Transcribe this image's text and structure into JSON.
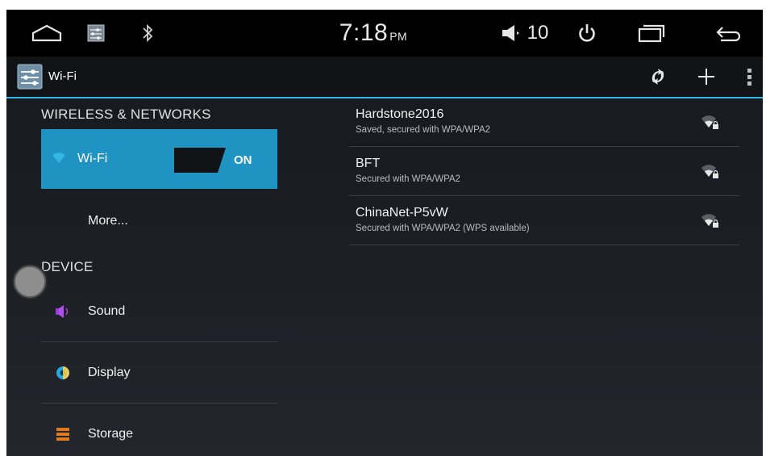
{
  "statusbar": {
    "time": "7:18",
    "ampm": "PM",
    "volume": "10",
    "icons": [
      "home-icon",
      "settings-app-icon",
      "bluetooth-icon",
      "volume-icon",
      "power-icon",
      "recents-icon",
      "back-icon"
    ]
  },
  "actionbar": {
    "title": "Wi-Fi",
    "icons": [
      "settings-app-icon",
      "wps-icon",
      "add-network-icon",
      "overflow-menu-icon"
    ]
  },
  "left": {
    "wireless_header": "WIRELESS & NETWORKS",
    "wifi_label": "Wi-Fi",
    "wifi_toggle": "ON",
    "more_label": "More...",
    "device_header": "DEVICE",
    "sound_label": "Sound",
    "display_label": "Display",
    "storage_label": "Storage"
  },
  "networks": [
    {
      "name": "Hardstone2016",
      "status": "Saved, secured with WPA/WPA2"
    },
    {
      "name": "BFT",
      "status": "Secured with WPA/WPA2"
    },
    {
      "name": "ChinaNet-P5vW",
      "status": "Secured with WPA/WPA2 (WPS available)"
    }
  ],
  "colors": {
    "accent": "#33b5e5",
    "selected_bg": "#1f93c2",
    "sound_icon": "#9b3fd6",
    "display_icon": "#2aa7e0",
    "storage_icon": "#e07a1f"
  }
}
